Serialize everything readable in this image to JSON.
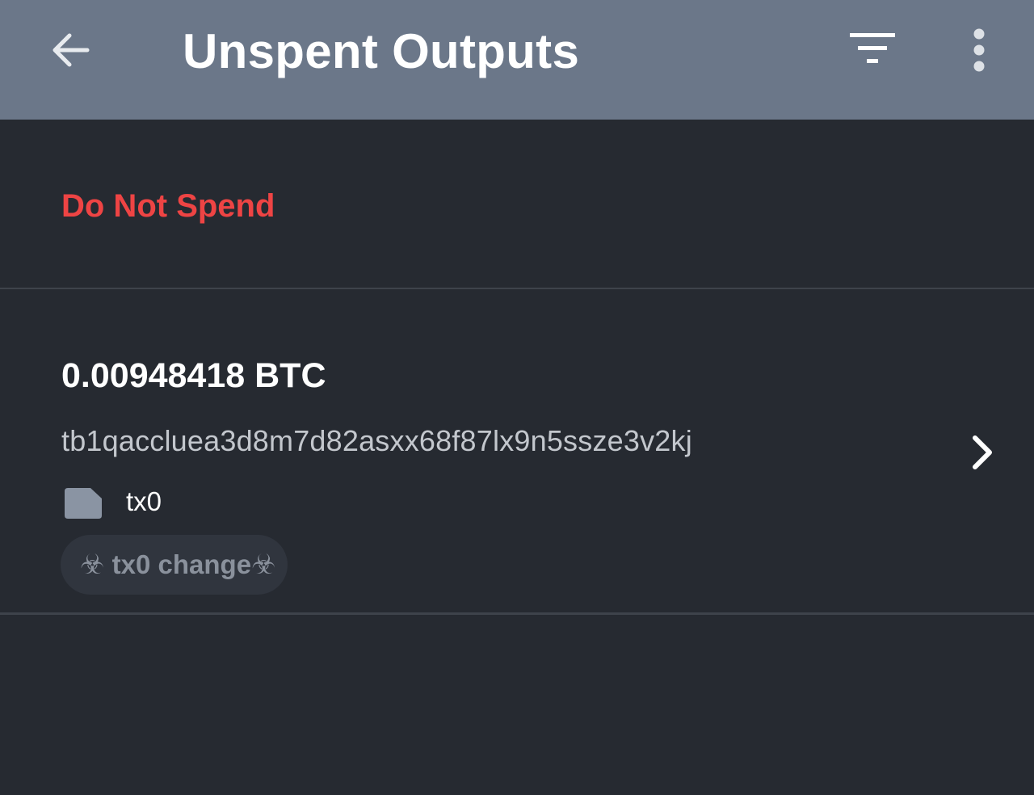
{
  "appbar": {
    "title": "Unspent Outputs",
    "back_icon": "arrow-left-icon",
    "filter_icon": "filter-icon",
    "more_icon": "more-vert-icon"
  },
  "section": {
    "title": "Do Not Spend"
  },
  "utxos": [
    {
      "amount": "0.00948418 BTC",
      "address": "tb1qaccluea3d8m7d82asxx68f87lx9n5ssze3v2kj",
      "label_icon": "label-tag-icon",
      "label": "tx0",
      "chip": {
        "prefix": "☣",
        "text": " tx0 change",
        "suffix": "☣"
      },
      "chevron_icon": "chevron-right-icon"
    }
  ],
  "colors": {
    "appbar_bg": "#6b7789",
    "page_bg": "#262a31",
    "section_title": "#ee4444",
    "chip_bg": "#30353e",
    "chip_text": "#8a919c"
  }
}
